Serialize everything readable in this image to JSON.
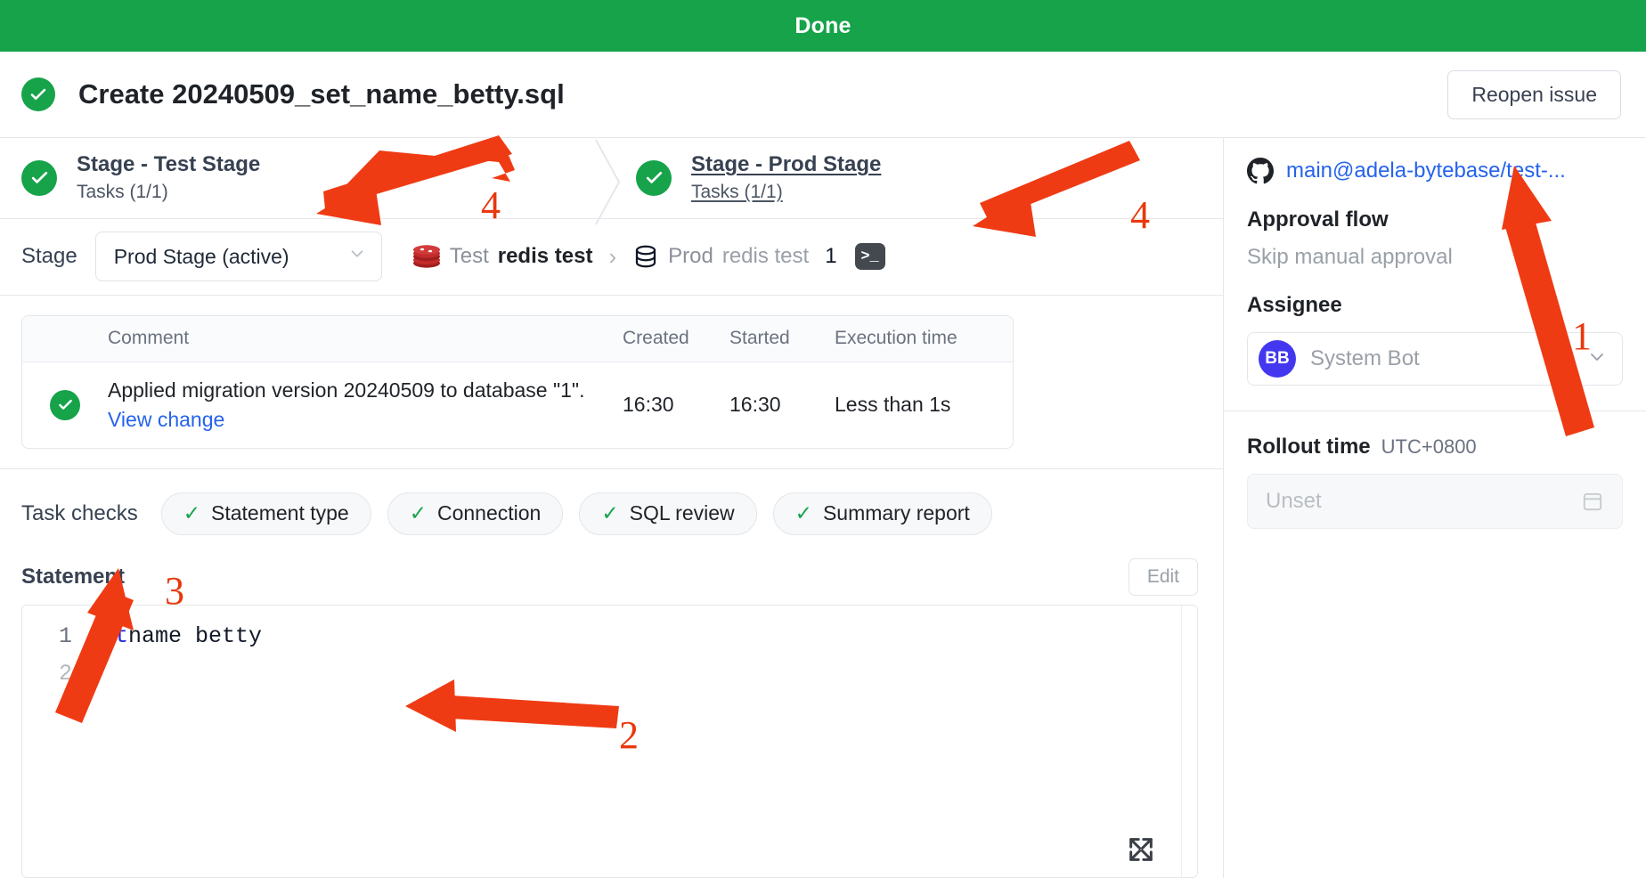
{
  "banner": {
    "status": "Done"
  },
  "header": {
    "title": "Create 20240509_set_name_betty.sql",
    "reopen_label": "Reopen issue",
    "status_icon": "check-circle-icon"
  },
  "pipeline": {
    "stages": [
      {
        "name": "Stage - Test Stage",
        "tasks": "Tasks (1/1)",
        "active": false
      },
      {
        "name": "Stage - Prod Stage",
        "tasks": "Tasks (1/1)",
        "active": true
      }
    ]
  },
  "stage_selector": {
    "label": "Stage",
    "selected": "Prod Stage (active)",
    "options": [
      "Test Stage",
      "Prod Stage (active)"
    ],
    "breadcrumb": {
      "source_env": "Test",
      "source_db": "redis test",
      "separator": "›",
      "target_env": "Prod",
      "target_db": "redis test",
      "index": "1",
      "terminal_icon": ">_"
    }
  },
  "task_table": {
    "columns": [
      "Comment",
      "Created",
      "Started",
      "Execution time"
    ],
    "rows": [
      {
        "status_icon": "check-circle-icon",
        "comment": "Applied migration version 20240509 to database \"1\".",
        "link": "View change",
        "created": "16:30",
        "started": "16:30",
        "execution_time": "Less than 1s"
      }
    ]
  },
  "task_checks": {
    "label": "Task checks",
    "items": [
      {
        "name": "Statement type",
        "status": "pass"
      },
      {
        "name": "Connection",
        "status": "pass"
      },
      {
        "name": "SQL review",
        "status": "pass"
      },
      {
        "name": "Summary report",
        "status": "pass"
      }
    ]
  },
  "statement": {
    "title": "Statement",
    "edit_label": "Edit",
    "lines": [
      {
        "number": "1",
        "keyword": "set",
        "rest": " name betty"
      },
      {
        "number": "2",
        "keyword": "",
        "rest": ""
      }
    ],
    "expand_icon": "expand-arrows-icon"
  },
  "sidebar": {
    "repo": "main@adela-bytebase/test-...",
    "repo_icon": "github-icon",
    "approval_flow_title": "Approval flow",
    "approval_flow_value": "Skip manual approval",
    "assignee_title": "Assignee",
    "assignee_initials": "BB",
    "assignee_name": "System Bot",
    "rollout_title": "Rollout time",
    "rollout_timezone": "UTC+0800",
    "rollout_value": "Unset"
  },
  "annotations": {
    "markers": [
      "1",
      "2",
      "3",
      "4",
      "4"
    ],
    "color": "#e8380d"
  },
  "colors": {
    "success": "#16a34a",
    "link": "#2563eb",
    "avatar": "#4338ef",
    "annotation": "#e8380d"
  }
}
